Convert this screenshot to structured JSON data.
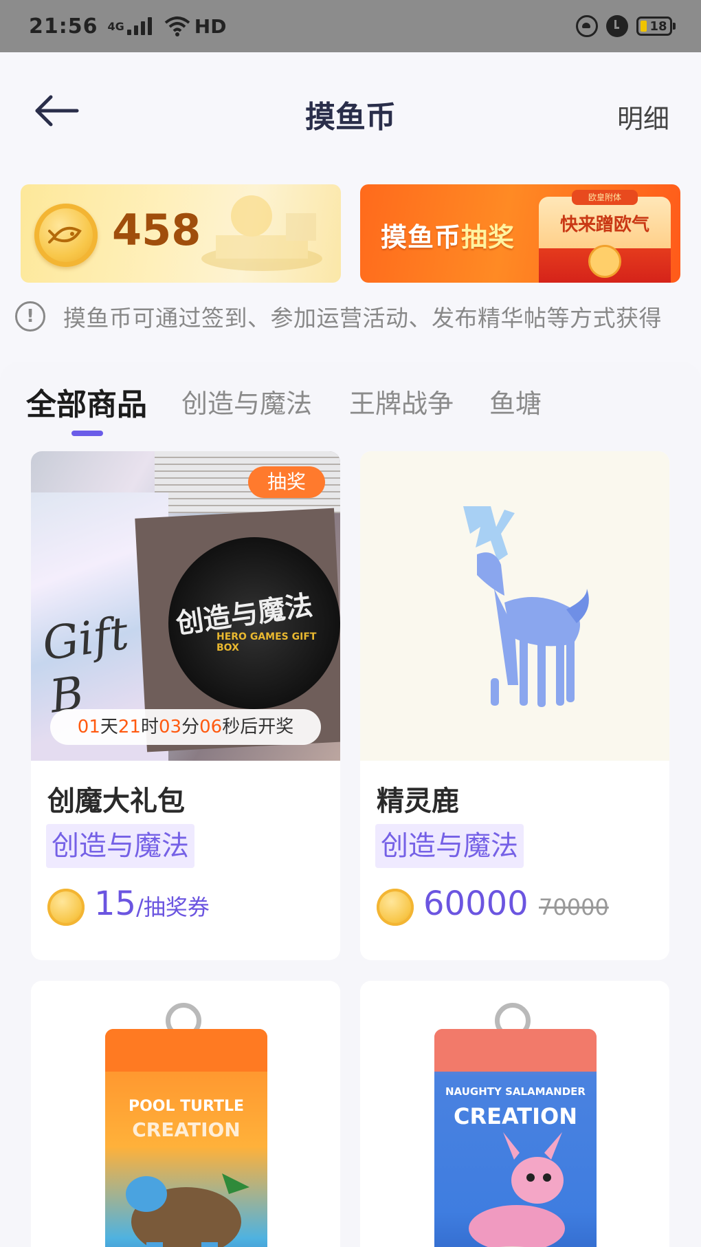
{
  "status_bar": {
    "time": "21:56",
    "network": "4G",
    "wifi_label": "HD",
    "battery": "18"
  },
  "header": {
    "title": "摸鱼币",
    "detail_label": "明细"
  },
  "balance": {
    "amount": "458"
  },
  "lottery_banner": {
    "text_main": "摸鱼币",
    "text_accent": "抽奖",
    "card_label": "快来蹭欧气",
    "card_top": "欧皇附体"
  },
  "tip": {
    "text": "摸鱼币可通过签到、参加运营活动、发布精华帖等方式获得"
  },
  "tabs": [
    {
      "label": "全部商品",
      "active": true
    },
    {
      "label": "创造与魔法",
      "active": false
    },
    {
      "label": "王牌战争",
      "active": false
    },
    {
      "label": "鱼塘",
      "active": false
    }
  ],
  "products": [
    {
      "name": "创魔大礼包",
      "tag": "创造与魔法",
      "badge": "抽奖",
      "price": "15",
      "price_unit": "/抽奖券",
      "countdown": {
        "days": "01",
        "d_label": "天",
        "hours": "21",
        "h_label": "时",
        "minutes": "03",
        "m_label": "分",
        "seconds": "06",
        "s_label": "秒后开奖"
      },
      "image_text": {
        "bag": "Gift B",
        "disc": "创造与魔法",
        "disc_sub": "HERO GAMES GIFT BOX"
      }
    },
    {
      "name": "精灵鹿",
      "tag": "创造与魔法",
      "price": "60000",
      "old_price": "70000"
    },
    {
      "image_text": {
        "line1": "POOL TURTLE",
        "line2": "CREATION"
      }
    },
    {
      "image_text": {
        "line1": "NAUGHTY SALAMANDER",
        "line2": "CREATION"
      }
    }
  ],
  "colors": {
    "accent": "#6a5ce8",
    "price": "#6b55e0",
    "tag_bg": "#efeaff",
    "badge": "#ff7a2d",
    "countdown_number": "#ff5a10"
  }
}
